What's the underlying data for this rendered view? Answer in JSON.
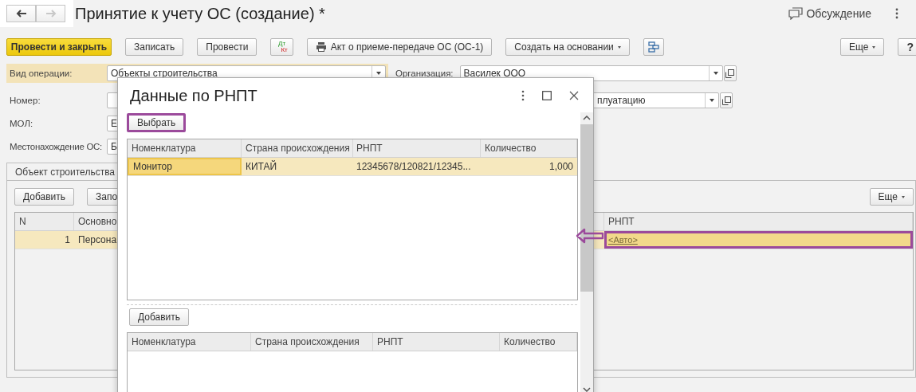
{
  "nav": [
    {
      "kind": "back",
      "disabled": false
    },
    {
      "kind": "forward",
      "disabled": true
    }
  ],
  "title": "Принятие к учету ОС (создание) *",
  "discussion": "Обсуждение",
  "toolbar": [
    {
      "kind": "primary",
      "label": "Провести и закрыть"
    },
    {
      "kind": "button",
      "label": "Записать"
    },
    {
      "kind": "button",
      "label": "Провести"
    },
    {
      "kind": "dtkt",
      "top": "Дт",
      "bottom": "Кт"
    },
    {
      "kind": "print",
      "label": "Акт о приеме-передаче ОС (ОС-1)"
    },
    {
      "kind": "menu",
      "label": "Создать на основании"
    },
    {
      "kind": "structure"
    }
  ],
  "toolbar_right": [
    {
      "kind": "menu",
      "label": "Еще"
    },
    {
      "kind": "button",
      "label": "?"
    }
  ],
  "operation": {
    "label": "Вид операции:",
    "value": "Объекты строительства"
  },
  "organization": {
    "label": "Организация:",
    "value": "Василек ООО"
  },
  "number": {
    "label": "Номер:"
  },
  "commissioning": {
    "value": "плуатацию"
  },
  "mol": {
    "label": "МОЛ:",
    "value": "Е"
  },
  "location": {
    "label": "Местонахождение ОС:",
    "value": "Б"
  },
  "tabs": [
    {
      "label": "Объект строительства",
      "selected": true
    }
  ],
  "panel": {
    "buttons": [
      "Добавить",
      "Запо"
    ],
    "more": "Еще",
    "table": {
      "columns": [
        "N",
        "Основно",
        "РНПТ"
      ],
      "rows": [
        {
          "selected": true,
          "cells": [
            {
              "text": "1",
              "highlighted": false
            },
            {
              "text": "Персона",
              "highlighted": false
            },
            {
              "text": "<Авто>",
              "highlighted": true
            }
          ]
        }
      ]
    }
  },
  "dialog": {
    "title": "Данные по РНПТ",
    "select_button": {
      "label": "Выбрать",
      "highlighted": true
    },
    "table": {
      "columns": [
        "Номенклатура",
        "Страна происхождения",
        "РНПТ",
        "Количество"
      ],
      "rows": [
        {
          "selected": true,
          "cells": [
            {
              "text": "Монитор",
              "current": true
            },
            {
              "text": "КИТАЙ",
              "current": false
            },
            {
              "text": "12345678/120821/12345...",
              "current": false
            },
            {
              "text": "1,000",
              "current": false
            }
          ]
        }
      ]
    },
    "add_button": "Добавить",
    "table2": {
      "columns": [
        "Номенклатура",
        "Страна происхождения",
        "РНПТ",
        "Количество"
      ]
    }
  }
}
